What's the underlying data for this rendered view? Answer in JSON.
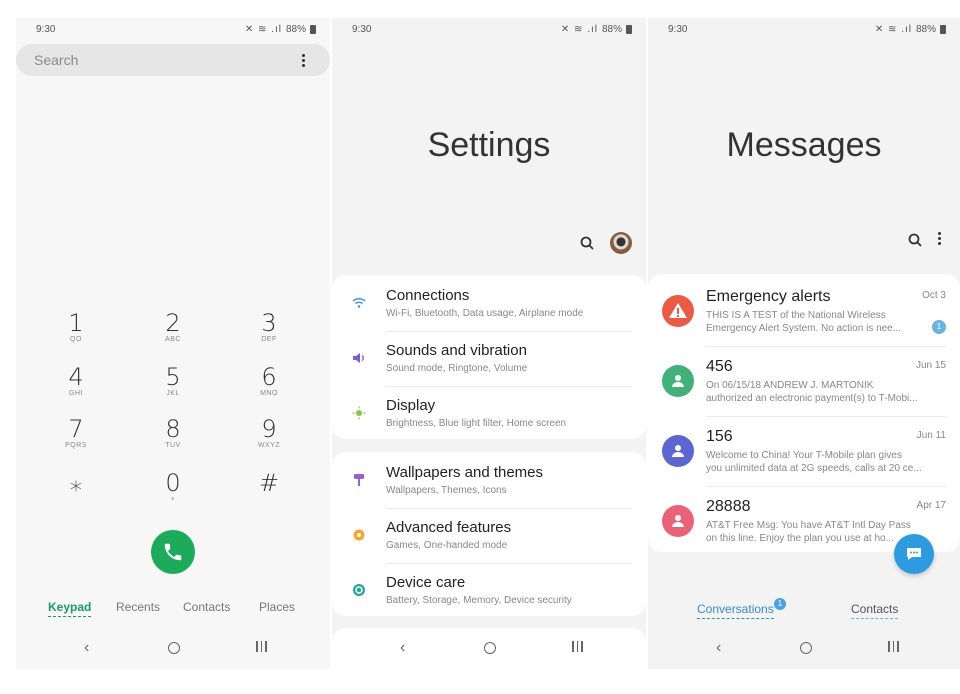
{
  "phone": {
    "status": {
      "time": "9:30",
      "battery": "88%"
    },
    "search_placeholder": "Search",
    "keys": [
      {
        "digit": "1",
        "letters": "QO"
      },
      {
        "digit": "2",
        "letters": "ABC"
      },
      {
        "digit": "3",
        "letters": "DEF"
      },
      {
        "digit": "4",
        "letters": "GHI"
      },
      {
        "digit": "5",
        "letters": "JKL"
      },
      {
        "digit": "6",
        "letters": "MNO"
      },
      {
        "digit": "7",
        "letters": "PQRS"
      },
      {
        "digit": "8",
        "letters": "TUV"
      },
      {
        "digit": "9",
        "letters": "WXYZ"
      },
      {
        "digit": "⁎",
        "letters": ""
      },
      {
        "digit": "0",
        "letters": "+"
      },
      {
        "digit": "#",
        "letters": ""
      }
    ],
    "tabs": [
      "Keypad",
      "Recents",
      "Contacts",
      "Places"
    ],
    "active_tab": "Keypad"
  },
  "settings": {
    "status": {
      "time": "9:30",
      "battery": "88%"
    },
    "title": "Settings",
    "groups": [
      [
        {
          "title": "Connections",
          "subtitle": "Wi-Fi, Bluetooth, Data usage, Airplane mode",
          "icon": "wifi-icon",
          "color": "#4a90d9"
        },
        {
          "title": "Sounds and vibration",
          "subtitle": "Sound mode, Ringtone, Volume",
          "icon": "volume-icon",
          "color": "#7b5fd0"
        },
        {
          "title": "Display",
          "subtitle": "Brightness, Blue light filter, Home screen",
          "icon": "brightness-icon",
          "color": "#8bc34a"
        }
      ],
      [
        {
          "title": "Wallpapers and themes",
          "subtitle": "Wallpapers, Themes, Icons",
          "icon": "paintbrush-icon",
          "color": "#9c5fd0"
        },
        {
          "title": "Advanced features",
          "subtitle": "Games, One-handed mode",
          "icon": "gear-plus-icon",
          "color": "#f0a830"
        },
        {
          "title": "Device care",
          "subtitle": "Battery, Storage, Memory, Device security",
          "icon": "device-care-icon",
          "color": "#26a69a"
        }
      ]
    ]
  },
  "messages": {
    "status": {
      "time": "9:30",
      "battery": "88%"
    },
    "title": "Messages",
    "conversations": [
      {
        "name": "Emergency alerts",
        "date": "Oct 3",
        "line1": "THIS IS A TEST of the National Wireless",
        "line2": "Emergency Alert System. No action is nee...",
        "avatar_color": "#ea5a44",
        "avatar_icon": "warning-icon",
        "unread": "1"
      },
      {
        "name": "456",
        "date": "Jun 15",
        "line1": "On 06/15/18 ANDREW J. MARTONIK",
        "line2": "authorized an electronic payment(s) to T-Mobi...",
        "avatar_color": "#43b07a",
        "avatar_icon": "person-icon",
        "unread": ""
      },
      {
        "name": "156",
        "date": "Jun 11",
        "line1": "Welcome to China! Your T-Mobile plan gives",
        "line2": "you unlimited data at 2G speeds, calls at 20 ce...",
        "avatar_color": "#5b66d0",
        "avatar_icon": "person-icon",
        "unread": ""
      },
      {
        "name": "28888",
        "date": "Apr 17",
        "line1": "AT&T Free Msg:  You have AT&T Intl Day Pass",
        "line2": "on this line. Enjoy the plan you use at ho...",
        "avatar_color": "#ea6277",
        "avatar_icon": "person-icon",
        "unread": ""
      }
    ],
    "tabs": [
      "Conversations",
      "Contacts"
    ],
    "conversations_badge": "1"
  }
}
